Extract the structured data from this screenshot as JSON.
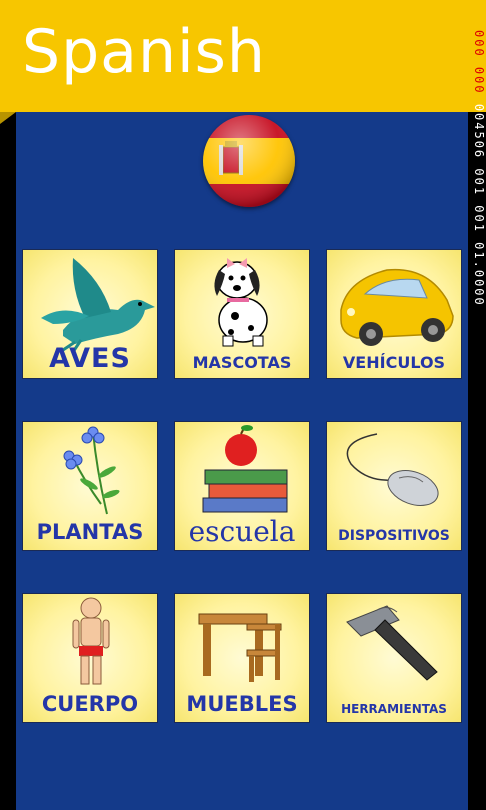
{
  "header": {
    "title": "Spanish"
  },
  "debug": {
    "reds": "000 000",
    "text": "004506 001 001 01.0000"
  },
  "flag": {
    "icon": "spain-flag-icon",
    "colors": {
      "red": "#c60b1e",
      "yellow": "#ffc400"
    }
  },
  "categories": [
    {
      "label": "AVES",
      "icon": "bird-icon"
    },
    {
      "label": "MASCOTAS",
      "icon": "dog-icon"
    },
    {
      "label": "VEHÍCULOS",
      "icon": "car-icon"
    },
    {
      "label": "PLANTAS",
      "icon": "flower-icon"
    },
    {
      "label": "escuela",
      "icon": "books-apple-icon"
    },
    {
      "label": "DISPOSITIVOS",
      "icon": "computer-mouse-icon"
    },
    {
      "label": "CUERPO",
      "icon": "body-icon"
    },
    {
      "label": "MUEBLES",
      "icon": "desk-chair-icon"
    },
    {
      "label": "HERRAMIENTAS",
      "icon": "hammer-icon"
    }
  ],
  "colors": {
    "header": "#f7c600",
    "panel": "#143a8a",
    "label": "#2436a8"
  }
}
